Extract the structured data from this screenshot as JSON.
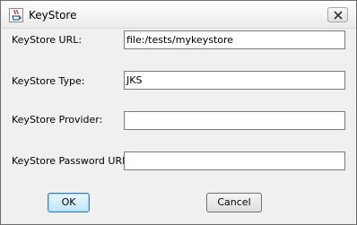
{
  "window": {
    "title": "KeyStore",
    "app_icon": "java-cup-icon",
    "close_icon": "close-icon"
  },
  "fields": [
    {
      "label": "KeyStore URL:",
      "value": "file:/tests/mykeystore"
    },
    {
      "label": "KeyStore Type:",
      "value": "JKS"
    },
    {
      "label": "KeyStore Provider:",
      "value": ""
    },
    {
      "label": "KeyStore Password URL:",
      "value": ""
    }
  ],
  "buttons": {
    "ok": "OK",
    "cancel": "Cancel"
  }
}
